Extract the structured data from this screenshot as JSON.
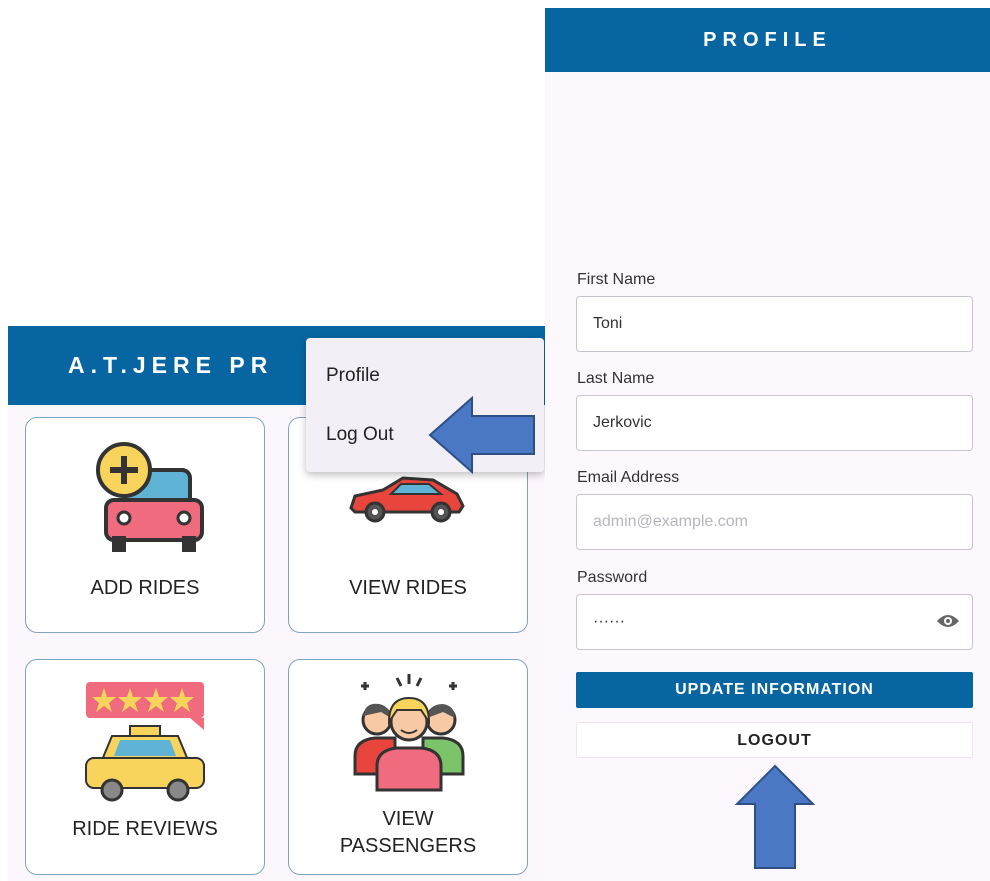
{
  "home": {
    "title": "A.T.JERE PR",
    "tiles": [
      {
        "label": "ADD RIDES",
        "icon": "add-car-icon"
      },
      {
        "label": "VIEW RIDES",
        "icon": "sports-car-icon"
      },
      {
        "label": "RIDE REVIEWS",
        "icon": "taxi-review-icon"
      },
      {
        "label_line1": "VIEW",
        "label_line2": "PASSENGERS",
        "icon": "passengers-icon"
      }
    ]
  },
  "menu": {
    "items": [
      "Profile",
      "Log Out"
    ]
  },
  "profile": {
    "title": "PROFILE",
    "first_name": {
      "label": "First Name",
      "value": "Toni"
    },
    "last_name": {
      "label": "Last Name",
      "value": "Jerkovic"
    },
    "email": {
      "label": "Email Address",
      "placeholder": "admin@example.com"
    },
    "password": {
      "label": "Password",
      "value": "······"
    },
    "update_button": "UPDATE INFORMATION",
    "logout_button": "LOGOUT"
  },
  "colors": {
    "primary": "#0766a2",
    "arrow": "#4b78c4",
    "panel_bg": "#fcf7fd"
  }
}
